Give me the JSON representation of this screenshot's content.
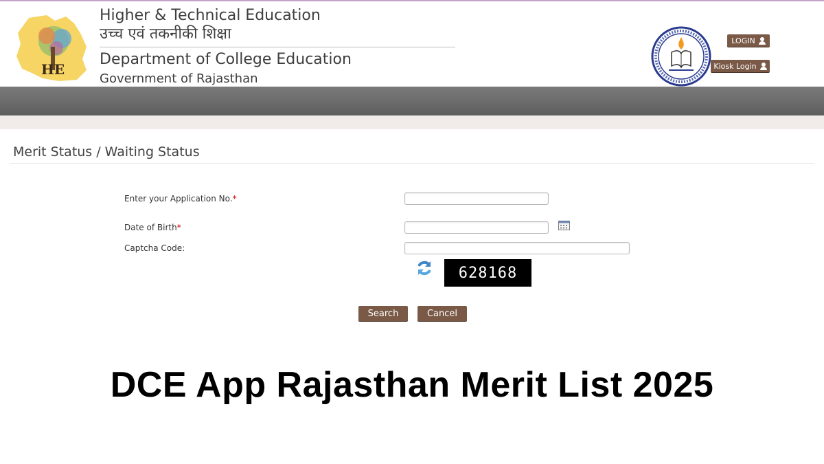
{
  "header": {
    "title_line1": "Higher & Technical Education",
    "title_line2": "उच्च एवं तकनीकी शिक्षा",
    "title_line3": "Department of College Education",
    "title_line4": "Government of Rajasthan",
    "logo_letters": "HE",
    "login_label": "LOGIN",
    "kiosk_login_label": "Kiosk Login"
  },
  "page": {
    "heading": "Merit Status / Waiting Status"
  },
  "form": {
    "application_no_label": "Enter your Application No.",
    "dob_label": "Date of Birth",
    "captcha_label": "Captcha Code:",
    "required_mark": "*",
    "application_no_value": "",
    "dob_value": "",
    "captcha_value": "",
    "captcha_text": "628168",
    "search_label": "Search",
    "cancel_label": "Cancel"
  },
  "banner": {
    "title": "DCE App Rajasthan Merit List 2025"
  },
  "colors": {
    "button_brown": "#7a5a47",
    "nav_gray": "#6b6b6b",
    "required_red": "#d40000"
  },
  "icons": [
    "user-icon",
    "calendar-icon",
    "refresh-icon",
    "rajasthan-map-logo",
    "department-emblem"
  ]
}
